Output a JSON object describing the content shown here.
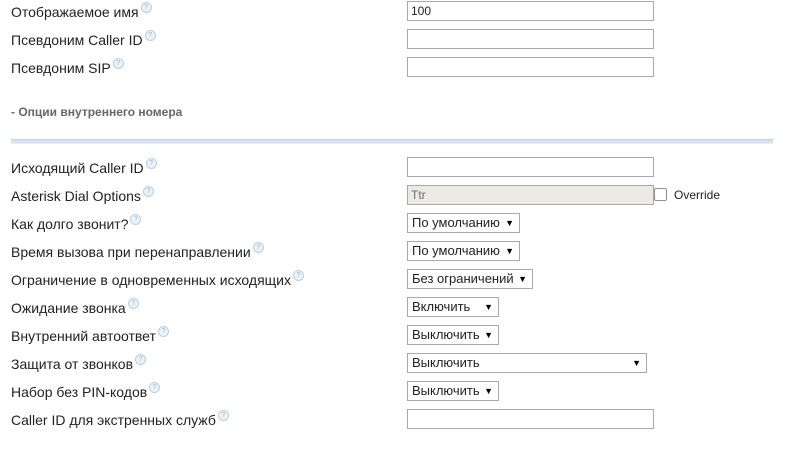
{
  "fields": {
    "display_name": {
      "label": "Отображаемое имя",
      "value": "100"
    },
    "cid_alias": {
      "label": "Псевдоним Caller ID",
      "value": ""
    },
    "sip_alias": {
      "label": "Псевдоним SIP",
      "value": ""
    }
  },
  "section": {
    "title": "- Опции внутреннего номера"
  },
  "options": {
    "outbound_cid": {
      "label": "Исходящий Caller ID",
      "value": ""
    },
    "dial_options": {
      "label": "Asterisk Dial Options",
      "value": "Ttr",
      "override_label": "Override",
      "override_checked": false
    },
    "ring_time": {
      "label": "Как долго звонит?",
      "selected": "По умолчанию"
    },
    "forward_ring_time": {
      "label": "Время вызова при перенаправлении",
      "selected": "По умолчанию"
    },
    "outbound_concurrency": {
      "label": "Ограничение в одновременных исходящих",
      "selected": "Без ограничений"
    },
    "call_waiting": {
      "label": "Ожидание звонка",
      "selected": "Включить"
    },
    "internal_autoanswer": {
      "label": "Внутренний автоответ",
      "selected": "Выключить"
    },
    "call_screening": {
      "label": "Защита от звонков",
      "selected": "Выключить"
    },
    "pinless_dialing": {
      "label": "Набор без PIN-кодов",
      "selected": "Выключить"
    },
    "emergency_cid": {
      "label": "Caller ID для экстренных служб",
      "value": ""
    }
  },
  "icons": {
    "help": "help-question-icon",
    "dropdown": "dropdown-arrow-icon"
  }
}
